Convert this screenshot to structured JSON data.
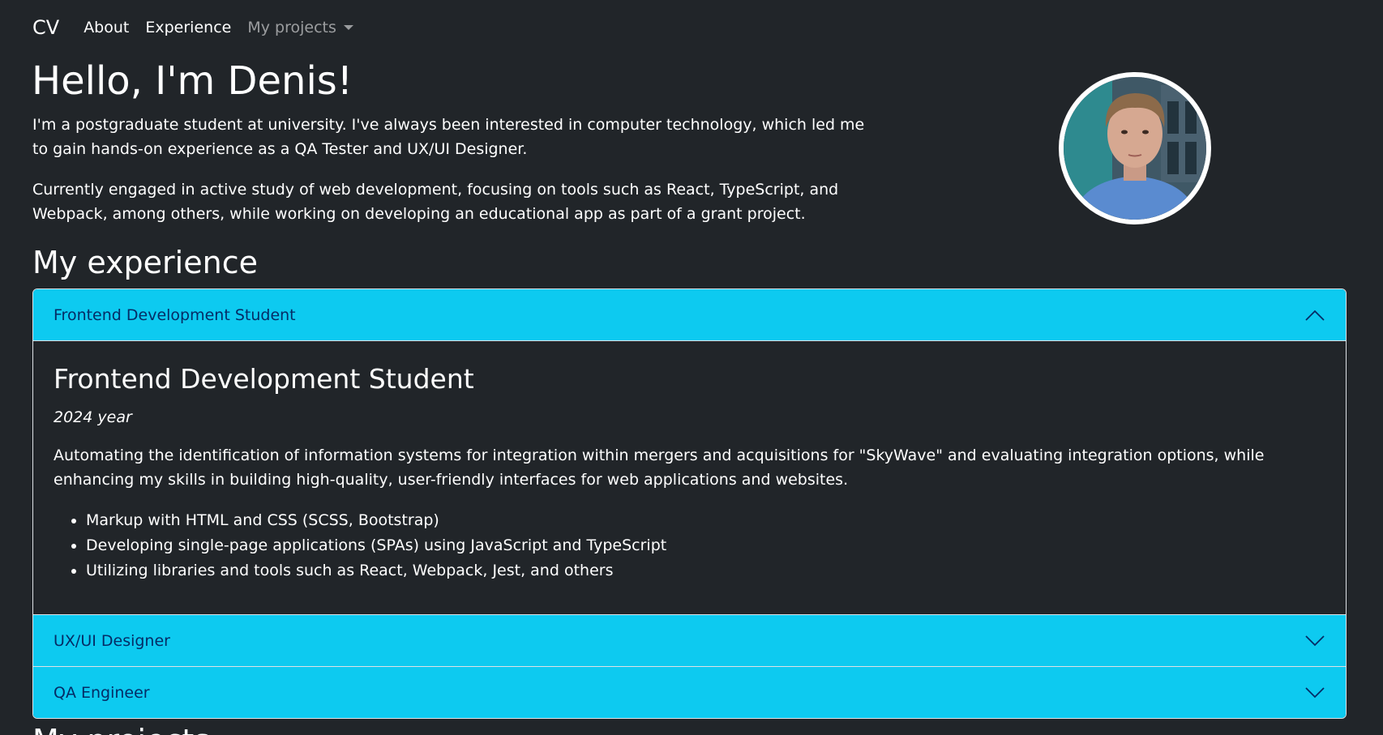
{
  "navbar": {
    "brand": "CV",
    "links": [
      {
        "label": "About"
      },
      {
        "label": "Experience"
      }
    ],
    "dropdown": {
      "label": "My projects"
    }
  },
  "hero": {
    "title": "Hello, I'm Denis!",
    "paragraphs": [
      "I'm a postgraduate student at university. I've always been interested in computer technology, which led me to gain hands-on experience as a QA Tester and UX/UI Designer.",
      "Currently engaged in active study of web development, focusing on tools such as React, TypeScript, and Webpack, among others, while working on developing an educational app as part of a grant project."
    ]
  },
  "experience": {
    "title": "My experience",
    "items": [
      {
        "header": "Frontend Development Student",
        "expanded": true,
        "title": "Frontend Development Student",
        "year": "2024 year",
        "description": "Automating the identification of information systems for integration within mergers and acquisitions for \"SkyWave\" and evaluating integration options, while enhancing my skills in building high-quality, user-friendly interfaces for web applications and websites.",
        "bullets": [
          "Markup with HTML and CSS (SCSS, Bootstrap)",
          "Developing single-page applications (SPAs) using JavaScript and TypeScript",
          "Utilizing libraries and tools such as React, Webpack, Jest, and others"
        ]
      },
      {
        "header": "UX/UI Designer",
        "expanded": false
      },
      {
        "header": "QA Engineer",
        "expanded": false
      }
    ]
  },
  "projects": {
    "title": "My projects"
  },
  "colors": {
    "background": "#212529",
    "accordion_header": "#0dcaf0",
    "accordion_header_text": "#052c65",
    "text": "#ffffff"
  },
  "icons": {
    "collapse": "chevron-up-icon",
    "expand": "chevron-down-icon",
    "dropdown": "caret-down-icon"
  }
}
